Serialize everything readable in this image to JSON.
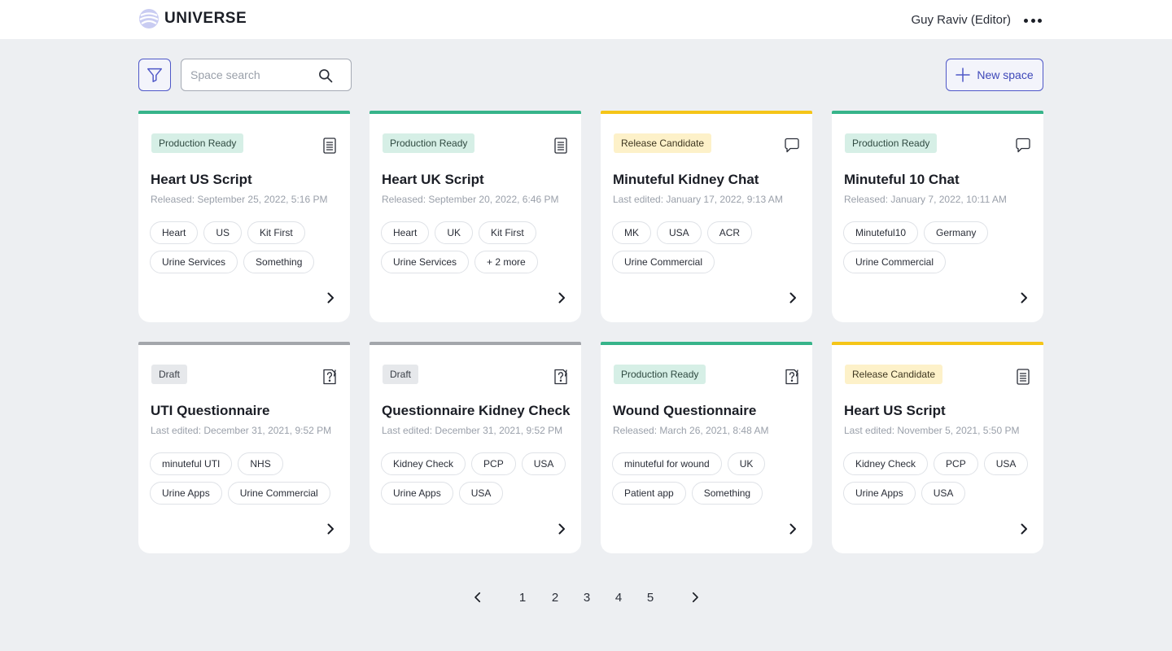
{
  "app": {
    "name": "UNIVERSE",
    "user": "Guy Raviv (Editor)",
    "more_icon": "more-horizontal-icon"
  },
  "toolbar": {
    "search_placeholder": "Space search",
    "search_value": "",
    "new_space_label": "New space",
    "filter_icon": "filter-icon",
    "search_icon": "search-icon",
    "plus_icon": "plus-icon"
  },
  "colors": {
    "accent": "#4f58c8",
    "production_ready": "#37b48a",
    "release_candidate": "#f5c518",
    "draft": "#a3a6ab"
  },
  "cards": [
    {
      "status": "Production Ready",
      "icon": "document-icon",
      "title": "Heart US Script",
      "meta": "Released: September 25, 2022, 5:16 PM",
      "tags": [
        "Heart",
        "US",
        "Kit First",
        "Urine Services",
        "Something"
      ]
    },
    {
      "status": "Production Ready",
      "icon": "document-icon",
      "title": "Heart UK Script",
      "meta": "Released: September 20, 2022, 6:46 PM",
      "tags": [
        "Heart",
        "UK",
        "Kit First",
        "Urine Services",
        "+ 2 more"
      ]
    },
    {
      "status": "Release Candidate",
      "icon": "chat-icon",
      "title": "Minuteful Kidney Chat",
      "meta": "Last edited: January 17, 2022, 9:13 AM",
      "tags": [
        "MK",
        "USA",
        "ACR",
        "Urine Commercial"
      ]
    },
    {
      "status": "Production Ready",
      "icon": "chat-icon",
      "title": "Minuteful 10 Chat",
      "meta": "Released: January 7, 2022, 10:11 AM",
      "tags": [
        "Minuteful10",
        "Germany",
        "Urine Commercial"
      ]
    },
    {
      "status": "Draft",
      "icon": "questionnaire-icon",
      "title": "UTI Questionnaire",
      "meta": "Last edited: December 31, 2021, 9:52 PM",
      "tags": [
        "minuteful UTI",
        "NHS",
        "Urine Apps",
        "Urine Commercial"
      ]
    },
    {
      "status": "Draft",
      "icon": "questionnaire-icon",
      "title": "Questionnaire Kidney Check",
      "meta": "Last edited: December 31, 2021, 9:52 PM",
      "tags": [
        "Kidney Check",
        "PCP",
        "USA",
        "Urine Apps",
        "USA"
      ]
    },
    {
      "status": "Production Ready",
      "icon": "questionnaire-icon",
      "title": "Wound Questionnaire",
      "meta": "Released: March 26, 2021, 8:48 AM",
      "tags": [
        "minuteful for wound",
        "UK",
        "Patient app",
        "Something"
      ]
    },
    {
      "status": "Release Candidate",
      "icon": "document-icon",
      "title": "Heart US Script",
      "meta": "Last edited: November 5, 2021, 5:50 PM",
      "tags": [
        "Kidney Check",
        "PCP",
        "USA",
        "Urine Apps",
        "USA"
      ]
    }
  ],
  "pagination": {
    "pages": [
      "1",
      "2",
      "3",
      "4",
      "5"
    ],
    "prev_icon": "chevron-left-icon",
    "next_icon": "chevron-right-icon"
  }
}
